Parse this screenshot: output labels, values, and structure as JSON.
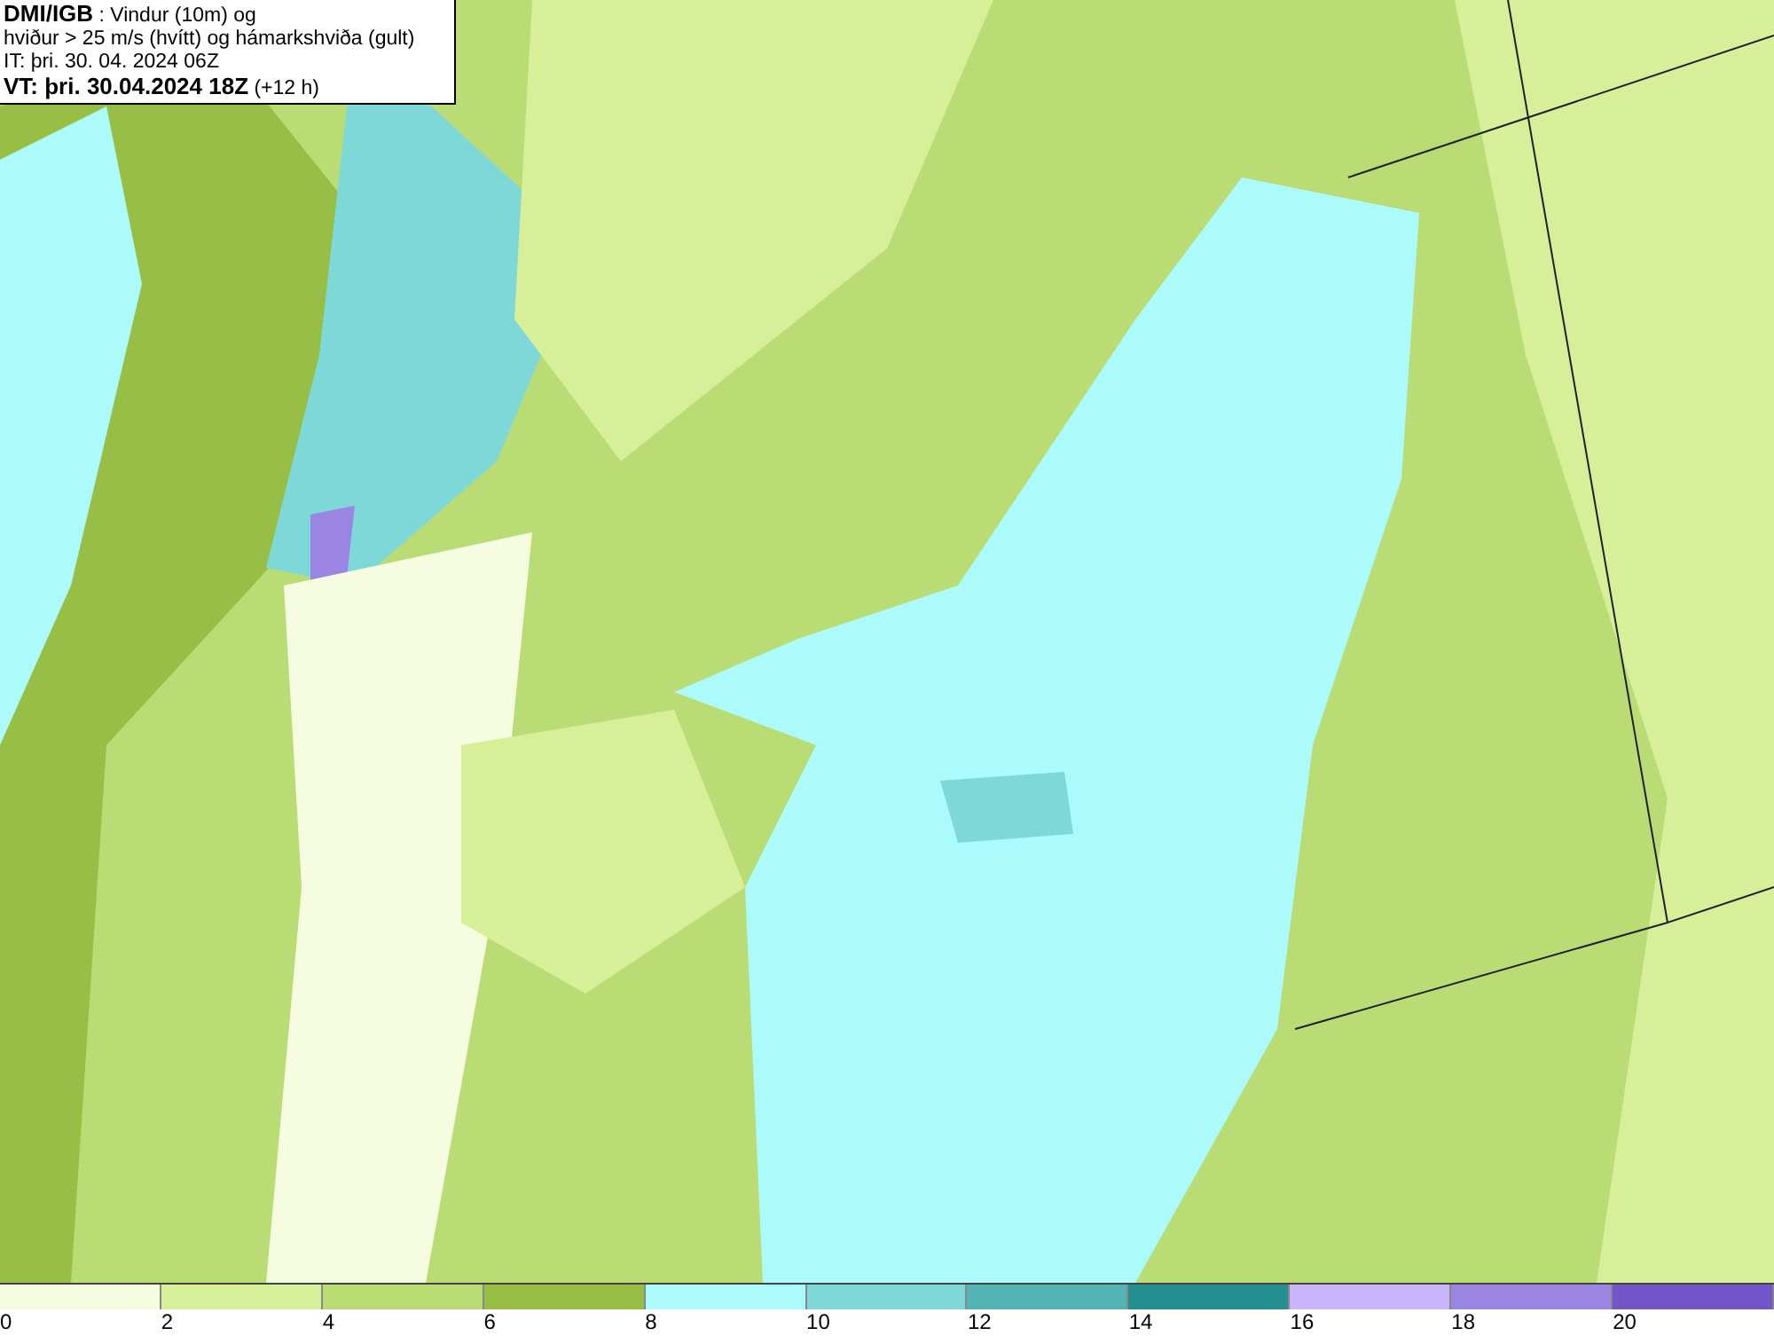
{
  "header": {
    "lines": [
      "**DMI/IGB** : Vindur (10m) og",
      "hviður > 25 m/s (hvítt) og hámarkshviða (gult)",
      "IT: þri. 30. 04. 2024 06Z",
      "**VT: þri. 30.04.2024 18Z** (+12 h)"
    ]
  },
  "legend": [
    {
      "label": "0",
      "color": "#f6fcdf"
    },
    {
      "label": "2",
      "color": "#d8ef9a"
    },
    {
      "label": "4",
      "color": "#b9dc74"
    },
    {
      "label": "6",
      "color": "#98bf45"
    },
    {
      "label": "8",
      "color": "#abfbfd"
    },
    {
      "label": "10",
      "color": "#7fd8d8"
    },
    {
      "label": "12",
      "color": "#53b3b4"
    },
    {
      "label": "14",
      "color": "#23908f"
    },
    {
      "label": "16",
      "color": "#c8b5fa"
    },
    {
      "label": "18",
      "color": "#9b85e2"
    },
    {
      "label": "20",
      "color": "#7256c9"
    }
  ]
}
